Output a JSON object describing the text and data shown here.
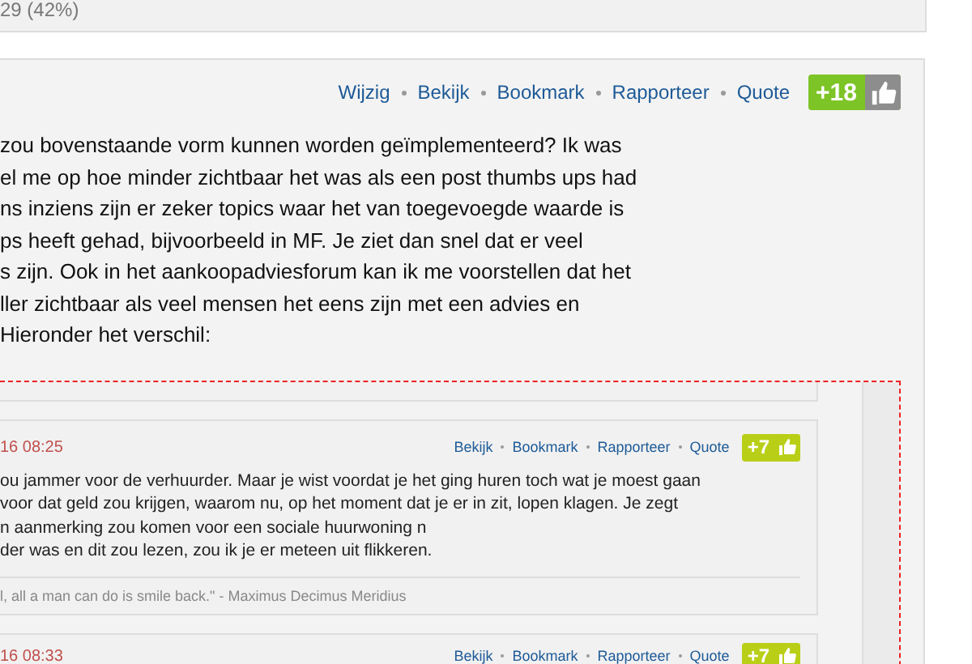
{
  "summary_panel": {
    "text": "29 (42%)"
  },
  "post": {
    "actions": [
      "Wijzig",
      "Bekijk",
      "Bookmark",
      "Rapporteer",
      "Quote"
    ],
    "score": "+18",
    "body_lines": [
      "zou bovenstaande vorm kunnen worden geïmplementeerd? Ik was",
      "el me op hoe minder zichtbaar het was als een post thumbs ups had",
      "ns inziens zijn er zeker topics waar het van toegevoegde waarde is",
      "ps heeft gehad, bijvoorbeeld in MF. Je ziet dan snel dat er veel",
      "s zijn. Ook in het aankoopadviesforum kan ik me voorstellen dat het",
      "ller zichtbaar als veel mensen het eens zijn met een advies en",
      "Hieronder het verschil:"
    ]
  },
  "embedded_screenshot": {
    "posts": [
      {
        "date": "16 08:25",
        "actions": [
          "Bekijk",
          "Bookmark",
          "Rapporteer",
          "Quote"
        ],
        "score": "+7",
        "body_lines": [
          "ou jammer voor de verhuurder. Maar je wist voordat je het ging huren toch wat je moest gaan",
          "voor dat geld zou krijgen, waarom nu, op het moment dat je er in zit, lopen klagen. Je zegt",
          "n aanmerking zou komen voor een sociale huurwoning n",
          "der was en dit zou lezen, zou ik je er meteen uit flikkeren."
        ],
        "signature": "l, all a man can do is smile back.\" - Maximus Decimus Meridius"
      },
      {
        "date": "16 08:33",
        "actions": [
          "Bekijk",
          "Bookmark",
          "Rapporteer",
          "Quote"
        ],
        "score": "+7"
      }
    ]
  }
}
